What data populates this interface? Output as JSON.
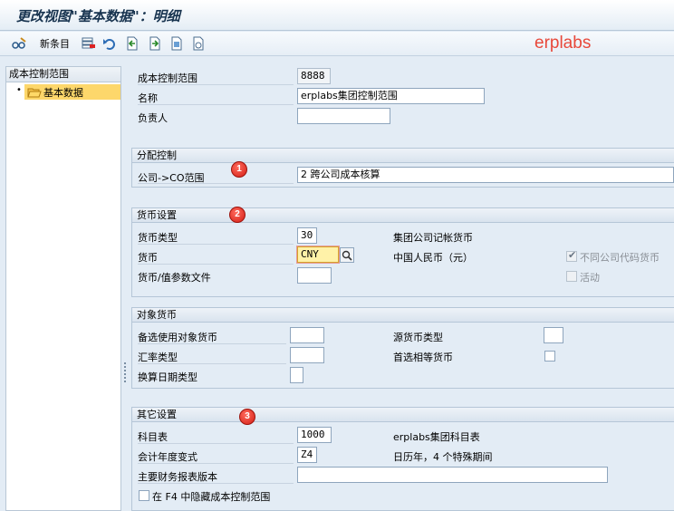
{
  "window": {
    "title": "更改视图\"基本数据\"：明细"
  },
  "toolbar": {
    "new_entries_label": "新条目",
    "brand_text": "erplabs",
    "brand_color": "#e8483a",
    "icons": [
      "glasses-edit-icon",
      "delete-row-icon",
      "undo-icon",
      "prev-entry-icon",
      "next-entry-icon",
      "export-icon",
      "select-all-icon"
    ]
  },
  "tree": {
    "header": "成本控制范围",
    "items": [
      {
        "label": "基本数据",
        "selected": true
      }
    ]
  },
  "basic": {
    "area_label": "成本控制范围",
    "area_value": "8888",
    "name_label": "名称",
    "name_value": "erplabs集团控制范围",
    "owner_label": "负责人",
    "owner_value": ""
  },
  "assignment": {
    "title": "分配控制",
    "badge": "1",
    "company_co_label": "公司->CO范围",
    "company_co_value": "2 跨公司成本核算"
  },
  "currency": {
    "title": "货币设置",
    "badge": "2",
    "type_label": "货币类型",
    "type_value": "30",
    "type_desc": "集团公司记帐货币",
    "currency_label": "货币",
    "currency_value": "CNY",
    "currency_desc": "中国人民币（元）",
    "profile_label": "货币/值参数文件",
    "profile_value": "",
    "diff_cc_label": "不同公司代码货币",
    "diff_cc_checked": true,
    "active_label": "活动",
    "active_checked": false
  },
  "object_currency": {
    "title": "对象货币",
    "alt_label": "备选使用对象货币",
    "alt_value": "",
    "source_type_label": "源货币类型",
    "source_type_value": "",
    "rate_type_label": "汇率类型",
    "rate_type_value": "",
    "pref_equal_label": "首选相等货币",
    "pref_equal_checked": false,
    "trans_date_label": "换算日期类型",
    "trans_date_value": ""
  },
  "other": {
    "title": "其它设置",
    "badge": "3",
    "coa_label": "科目表",
    "coa_value": "1000",
    "coa_desc": "erplabs集团科目表",
    "fyv_label": "会计年度变式",
    "fyv_value": "Z4",
    "fyv_desc": "日历年，4 个特殊期间",
    "fs_version_label": "主要财务报表版本",
    "fs_version_value": "",
    "hide_f4_label": "在 F4 中隐藏成本控制范围",
    "hide_f4_checked": false
  }
}
